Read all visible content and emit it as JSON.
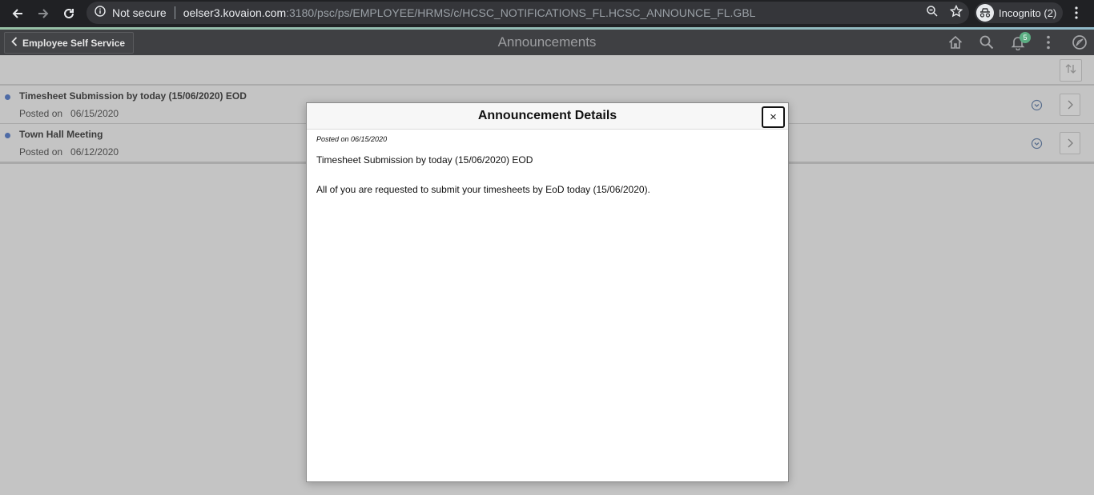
{
  "browser": {
    "security_label": "Not secure",
    "url_host": "oelser3.kovaion.com",
    "url_rest": ":3180/psc/ps/EMPLOYEE/HRMS/c/HCSC_NOTIFICATIONS_FL.HCSC_ANNOUNCE_FL.GBL",
    "profile_label": "Incognito (2)"
  },
  "header": {
    "back_label": "Employee Self Service",
    "title": "Announcements",
    "notification_count": "5"
  },
  "list": {
    "posted_label": "Posted on",
    "rows": [
      {
        "title": "Timesheet Submission by today (15/06/2020) EOD",
        "date": "06/15/2020"
      },
      {
        "title": "Town Hall Meeting",
        "date": "06/12/2020"
      }
    ]
  },
  "modal": {
    "title": "Announcement Details",
    "close_label": "×",
    "posted_text": "Posted on 06/15/2020",
    "announcement_title": "Timesheet Submission by today (15/06/2020) EOD",
    "body": "All of you are requested to submit your timesheets by EoD today (15/06/2020)."
  },
  "colors": {
    "header_bg": "#3f4043",
    "overlay_bg": "#c4c4c4",
    "badge": "#5cae83",
    "unread_dot": "#4e6ba6"
  }
}
